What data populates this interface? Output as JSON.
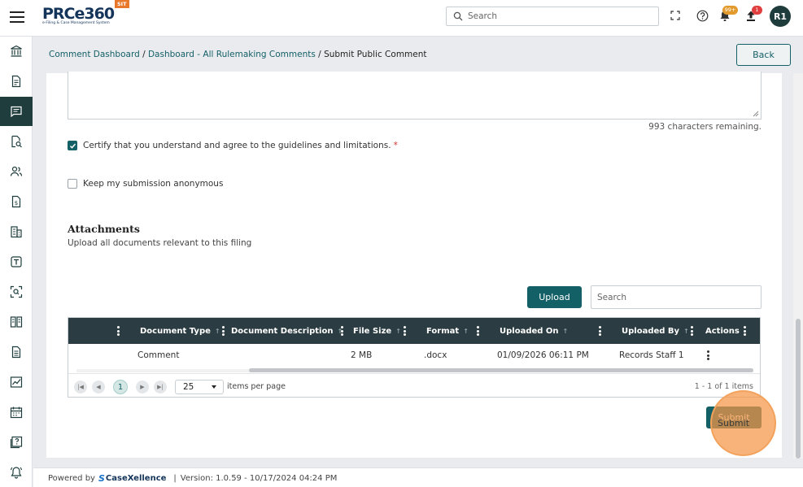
{
  "app": {
    "logo_text": "PRCe360",
    "logo_sub": "e-Filing & Case Management System",
    "env_badge": "SIT"
  },
  "topbar": {
    "search_placeholder": "Search",
    "notifications_badge": "99+",
    "uploads_badge": "1",
    "avatar_initials": "R1"
  },
  "breadcrumb": {
    "items": [
      "Comment Dashboard",
      "Dashboard - All Rulemaking Comments"
    ],
    "separator": " / ",
    "current": "Submit Public Comment"
  },
  "back_label": "Back",
  "form": {
    "chars_remaining": "993 characters remaining.",
    "certify_label": "Certify that you understand and agree to the guidelines and limitations.",
    "certify_required": "*",
    "certify_checked": true,
    "anonymous_label": "Keep my submission anonymous",
    "anonymous_checked": false
  },
  "attachments": {
    "title": "Attachments",
    "subtitle": "Upload all documents relevant to this filing",
    "upload_label": "Upload",
    "search_placeholder": "Search",
    "columns": [
      "Document Type",
      "Document Description",
      "File Size",
      "Format",
      "Uploaded On",
      "Uploaded By",
      "Actions"
    ],
    "rows": [
      {
        "document_type": "Comment",
        "description": "",
        "file_size": "2 MB",
        "format": ".docx",
        "uploaded_on": "01/09/2026 06:11 PM",
        "uploaded_by": "Records Staff 1"
      }
    ],
    "pager": {
      "current_page": "1",
      "page_size": "25",
      "items_per_page_label": "items per page",
      "range_label": "1 - 1 of 1 items"
    }
  },
  "submit_label": "Submit",
  "footer": {
    "powered_by": "Powered by",
    "brand_mark": "S",
    "brand": "CaseXellence",
    "separator": "|",
    "version": "Version: 1.0.59 - 10/17/2024 04:24 PM"
  },
  "colors": {
    "primary": "#146067",
    "sidebar_active": "#1f3d3d",
    "grid_header": "#2b3d42",
    "highlight": "#f5a05a"
  }
}
